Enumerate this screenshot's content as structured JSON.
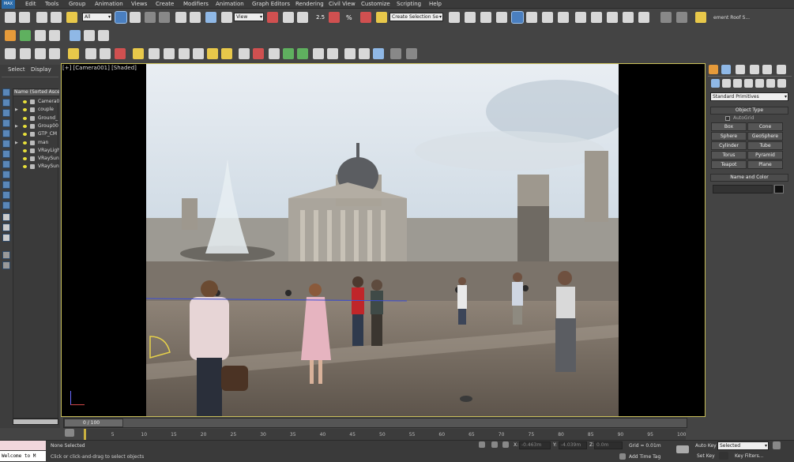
{
  "app": {
    "logo": "MAX"
  },
  "menus": [
    "Edit",
    "Tools",
    "Group",
    "Animation",
    "Views",
    "Create",
    "Modifiers",
    "Animation",
    "Graph Editors",
    "Rendering",
    "Civil View",
    "Customize",
    "Scripting",
    "Help"
  ],
  "toolbar": {
    "selection_filter": "All",
    "reference_coord": "View",
    "selection_set": "Create Selection Se",
    "snap_label_1": "2.5",
    "snap_label_2": "%",
    "light_list_label": "ement Roof S..."
  },
  "left_panel": {
    "tabs": [
      "Select",
      "Display"
    ],
    "header": "Name (Sorted Ascer",
    "items": [
      {
        "name": "Camera0",
        "expand": ""
      },
      {
        "name": "couple",
        "expand": "▶"
      },
      {
        "name": "Ground_",
        "expand": ""
      },
      {
        "name": "Group00",
        "expand": "▶"
      },
      {
        "name": "GTP_CM",
        "expand": ""
      },
      {
        "name": "man",
        "expand": "▶"
      },
      {
        "name": "VRayLigh",
        "expand": ""
      },
      {
        "name": "VRaySun",
        "expand": ""
      },
      {
        "name": "VRaySun",
        "expand": ""
      }
    ]
  },
  "viewport": {
    "label": "[+] [Camera001] [Shaded]"
  },
  "command_panel": {
    "dropdown": "Standard Primitives",
    "object_type_title": "Object Type",
    "autogrid": "AutoGrid",
    "buttons": [
      "Box",
      "Cone",
      "Sphere",
      "GeoSphere",
      "Cylinder",
      "Tube",
      "Torus",
      "Pyramid",
      "Teapot",
      "Plane"
    ],
    "name_color_title": "Name and Color"
  },
  "timeline": {
    "frame": "0 / 100",
    "ticks": [
      "0",
      "5",
      "10",
      "15",
      "20",
      "25",
      "30",
      "35",
      "40",
      "45",
      "50",
      "55",
      "60",
      "65",
      "70",
      "75",
      "80",
      "85",
      "90",
      "95",
      "100"
    ]
  },
  "status": {
    "welcome": "Welcome to M",
    "selection": "None Selected",
    "prompt": "Click or click-and-drag to select objects",
    "x_label": "X:",
    "x_value": "-0.463m",
    "y_label": "Y:",
    "y_value": "-4.039m",
    "z_label": "Z:",
    "z_value": "0.0m",
    "grid": "Grid = 0.01m",
    "add_time_tag": "Add Time Tag",
    "auto_key": "Auto Key",
    "set_key": "Set Key",
    "selected": "Selected",
    "key_filters": "Key Filters..."
  }
}
